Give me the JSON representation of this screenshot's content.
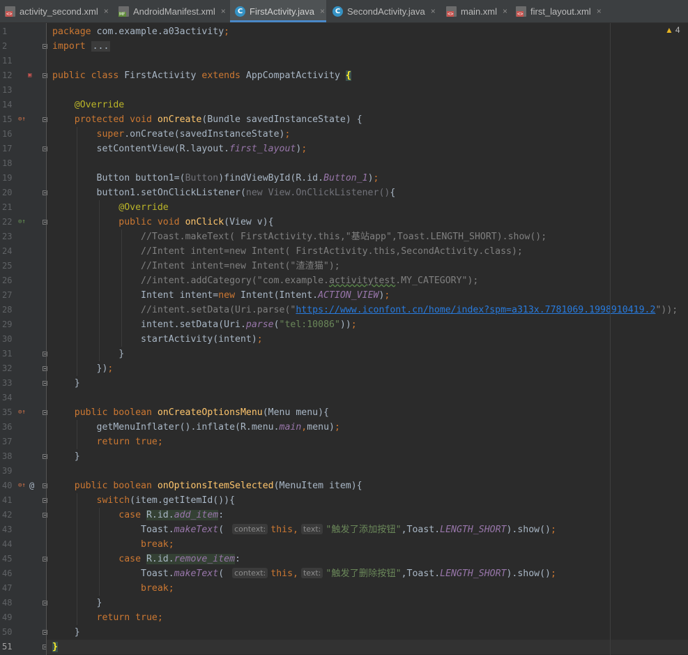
{
  "tabs": [
    {
      "label": "activity_second.xml",
      "icon": "xml-file-icon",
      "active": false
    },
    {
      "label": "AndroidManifest.xml",
      "icon": "manifest-file-icon",
      "active": false
    },
    {
      "label": "FirstActivity.java",
      "icon": "java-class-icon",
      "active": true
    },
    {
      "label": "SecondActivity.java",
      "icon": "java-class-icon",
      "active": false
    },
    {
      "label": "main.xml",
      "icon": "xml-file-icon",
      "active": false
    },
    {
      "label": "first_layout.xml",
      "icon": "xml-file-icon",
      "active": false
    }
  ],
  "tab_close_glyph": "×",
  "inspection": {
    "warning_count": "4"
  },
  "editor": {
    "current_line": "51",
    "lines": [
      {
        "n": "1",
        "spans": [
          [
            "kw",
            "package "
          ],
          [
            "",
            "com.example.a03activity"
          ],
          [
            "kw",
            ";"
          ]
        ]
      },
      {
        "n": "2",
        "spans": [
          [
            "kw",
            "import "
          ],
          [
            "fold-dots",
            "..."
          ]
        ]
      },
      {
        "n": "11",
        "spans": []
      },
      {
        "n": "12",
        "spans": [
          [
            "kw",
            "public class "
          ],
          [
            "",
            "FirstActivity "
          ],
          [
            "kw",
            "extends "
          ],
          [
            "",
            "AppCompatActivity "
          ],
          [
            "brace-hl",
            "{"
          ]
        ]
      },
      {
        "n": "13",
        "spans": []
      },
      {
        "n": "14",
        "spans": [
          [
            "",
            "    "
          ],
          [
            "ann",
            "@Override"
          ]
        ]
      },
      {
        "n": "15",
        "spans": [
          [
            "",
            "    "
          ],
          [
            "kw",
            "protected void "
          ],
          [
            "fn",
            "onCreate"
          ],
          [
            "",
            "(Bundle savedInstanceState) {"
          ]
        ]
      },
      {
        "n": "16",
        "spans": [
          [
            "",
            "        "
          ],
          [
            "kw",
            "super"
          ],
          [
            "",
            ".onCreate(savedInstanceState)"
          ],
          [
            "kw",
            ";"
          ]
        ]
      },
      {
        "n": "17",
        "spans": [
          [
            "",
            "        setContentView(R.layout."
          ],
          [
            "fld",
            "first_layout"
          ],
          [
            "",
            ")"
          ],
          [
            "kw",
            ";"
          ]
        ]
      },
      {
        "n": "18",
        "spans": []
      },
      {
        "n": "19",
        "spans": [
          [
            "",
            "        Button button1=("
          ],
          [
            "dim",
            "Button"
          ],
          [
            "",
            ")findViewById(R.id."
          ],
          [
            "fld",
            "Button_1"
          ],
          [
            "",
            ")"
          ],
          [
            "kw",
            ";"
          ]
        ]
      },
      {
        "n": "20",
        "spans": [
          [
            "",
            "        button1.setOnClickListener("
          ],
          [
            "dim",
            "new View.OnClickListener()"
          ],
          [
            "",
            "{"
          ]
        ]
      },
      {
        "n": "21",
        "spans": [
          [
            "",
            "            "
          ],
          [
            "ann",
            "@Override"
          ]
        ]
      },
      {
        "n": "22",
        "spans": [
          [
            "",
            "            "
          ],
          [
            "kw",
            "public void "
          ],
          [
            "fn",
            "onClick"
          ],
          [
            "",
            "(View v){"
          ]
        ]
      },
      {
        "n": "23",
        "spans": [
          [
            "",
            "                "
          ],
          [
            "cm",
            "//Toast.makeText( FirstActivity.this,\"基站app\",Toast.LENGTH_SHORT).show();"
          ]
        ]
      },
      {
        "n": "24",
        "spans": [
          [
            "",
            "                "
          ],
          [
            "cm",
            "//Intent intent=new Intent( FirstActivity.this,SecondActivity.class);"
          ]
        ]
      },
      {
        "n": "25",
        "spans": [
          [
            "",
            "                "
          ],
          [
            "cm",
            "//Intent intent=new Intent(\"渣渣猫\");"
          ]
        ]
      },
      {
        "n": "26",
        "spans": [
          [
            "",
            "                "
          ],
          [
            "cm",
            "//intent.addCategory(\"com.example."
          ],
          [
            "cm squig",
            "activitytest"
          ],
          [
            "cm",
            ".MY_CATEGORY\");"
          ]
        ]
      },
      {
        "n": "27",
        "spans": [
          [
            "",
            "                Intent intent="
          ],
          [
            "kw",
            "new "
          ],
          [
            "",
            "Intent(Intent."
          ],
          [
            "fld",
            "ACTION_VIEW"
          ],
          [
            "",
            ")"
          ],
          [
            "kw",
            ";"
          ]
        ]
      },
      {
        "n": "28",
        "spans": [
          [
            "",
            "                "
          ],
          [
            "cm",
            "//intent.setData(Uri.parse(\""
          ],
          [
            "url",
            "https://www.iconfont.cn/home/index?spm=a313x.7781069.1998910419.2"
          ],
          [
            "cm",
            "\"));"
          ]
        ]
      },
      {
        "n": "29",
        "spans": [
          [
            "",
            "                intent.setData(Uri."
          ],
          [
            "fld",
            "parse"
          ],
          [
            "",
            "("
          ],
          [
            "str",
            "\"tel:10086\""
          ],
          [
            "",
            "))"
          ],
          [
            "kw",
            ";"
          ]
        ]
      },
      {
        "n": "30",
        "spans": [
          [
            "",
            "                startActivity(intent)"
          ],
          [
            "kw",
            ";"
          ]
        ]
      },
      {
        "n": "31",
        "spans": [
          [
            "",
            "            }"
          ]
        ]
      },
      {
        "n": "32",
        "spans": [
          [
            "",
            "        })"
          ],
          [
            "kw",
            ";"
          ]
        ]
      },
      {
        "n": "33",
        "spans": [
          [
            "",
            "    }"
          ]
        ]
      },
      {
        "n": "34",
        "spans": []
      },
      {
        "n": "35",
        "spans": [
          [
            "",
            "    "
          ],
          [
            "kw",
            "public boolean "
          ],
          [
            "fn",
            "onCreateOptionsMenu"
          ],
          [
            "",
            "(Menu menu){"
          ]
        ]
      },
      {
        "n": "36",
        "spans": [
          [
            "",
            "        getMenuInflater().inflate(R.menu."
          ],
          [
            "fld",
            "main"
          ],
          [
            "kw",
            ","
          ],
          [
            "",
            "menu)"
          ],
          [
            "kw",
            ";"
          ]
        ]
      },
      {
        "n": "37",
        "spans": [
          [
            "",
            "        "
          ],
          [
            "kw",
            "return true;"
          ]
        ]
      },
      {
        "n": "38",
        "spans": [
          [
            "",
            "    }"
          ]
        ]
      },
      {
        "n": "39",
        "spans": []
      },
      {
        "n": "40",
        "spans": [
          [
            "",
            "    "
          ],
          [
            "kw",
            "public boolean "
          ],
          [
            "fn",
            "onOptionsItemSelected"
          ],
          [
            "",
            "(MenuItem item){"
          ]
        ]
      },
      {
        "n": "41",
        "spans": [
          [
            "",
            "        "
          ],
          [
            "kw",
            "switch"
          ],
          [
            "",
            "(item.getItemId()){"
          ]
        ]
      },
      {
        "n": "42",
        "spans": [
          [
            "",
            "            "
          ],
          [
            "kw",
            "case "
          ],
          [
            "id-hl",
            "R.id."
          ],
          [
            "fld id-hl",
            "add_item"
          ],
          [
            "",
            ":"
          ]
        ]
      },
      {
        "n": "43",
        "spans": [
          [
            "",
            "                Toast."
          ],
          [
            "fld",
            "makeText"
          ],
          [
            "",
            "( "
          ],
          [
            "hint",
            "context:"
          ],
          [
            "kw",
            "this,"
          ],
          [
            "hint",
            "text:"
          ],
          [
            "str",
            "\"触发了添加按钮\""
          ],
          [
            "",
            ",Toast."
          ],
          [
            "fld",
            "LENGTH_SHORT"
          ],
          [
            "",
            ").show()"
          ],
          [
            "kw",
            ";"
          ]
        ]
      },
      {
        "n": "44",
        "spans": [
          [
            "",
            "                "
          ],
          [
            "kw",
            "break;"
          ]
        ]
      },
      {
        "n": "45",
        "spans": [
          [
            "",
            "            "
          ],
          [
            "kw",
            "case "
          ],
          [
            "id-hl",
            "R.id."
          ],
          [
            "fld id-hl",
            "remove_item"
          ],
          [
            "",
            ":"
          ]
        ]
      },
      {
        "n": "46",
        "spans": [
          [
            "",
            "                Toast."
          ],
          [
            "fld",
            "makeText"
          ],
          [
            "",
            "( "
          ],
          [
            "hint",
            "context:"
          ],
          [
            "kw",
            "this,"
          ],
          [
            "hint",
            "text:"
          ],
          [
            "str",
            "\"触发了删除按钮\""
          ],
          [
            "",
            ",Toast."
          ],
          [
            "fld",
            "LENGTH_SHORT"
          ],
          [
            "",
            ").show()"
          ],
          [
            "kw",
            ";"
          ]
        ]
      },
      {
        "n": "47",
        "spans": [
          [
            "",
            "                "
          ],
          [
            "kw",
            "break;"
          ]
        ]
      },
      {
        "n": "48",
        "spans": [
          [
            "",
            "        }"
          ]
        ]
      },
      {
        "n": "49",
        "spans": [
          [
            "",
            "        "
          ],
          [
            "kw",
            "return true;"
          ]
        ]
      },
      {
        "n": "50",
        "spans": [
          [
            "",
            "    }"
          ]
        ]
      },
      {
        "n": "51",
        "spans": [
          [
            "brace-hl",
            "}"
          ]
        ]
      }
    ]
  },
  "gutter_marks": [
    {
      "line": "12",
      "icon": "android-activity-icon"
    },
    {
      "line": "15",
      "icon": "override-method-icon"
    },
    {
      "line": "22",
      "icon": "implement-method-icon"
    },
    {
      "line": "35",
      "icon": "override-method-icon"
    },
    {
      "line": "40",
      "icon": "override-method-icon"
    },
    {
      "line": "40",
      "icon": "annotation-at-icon"
    }
  ],
  "colors": {
    "background": "#2b2b2b",
    "keyword": "#cc7832",
    "method": "#ffc66d",
    "annotation": "#bbb529",
    "string": "#6a8759",
    "comment": "#808080",
    "field": "#9876aa",
    "active_tab_underline": "#4a88c7"
  }
}
